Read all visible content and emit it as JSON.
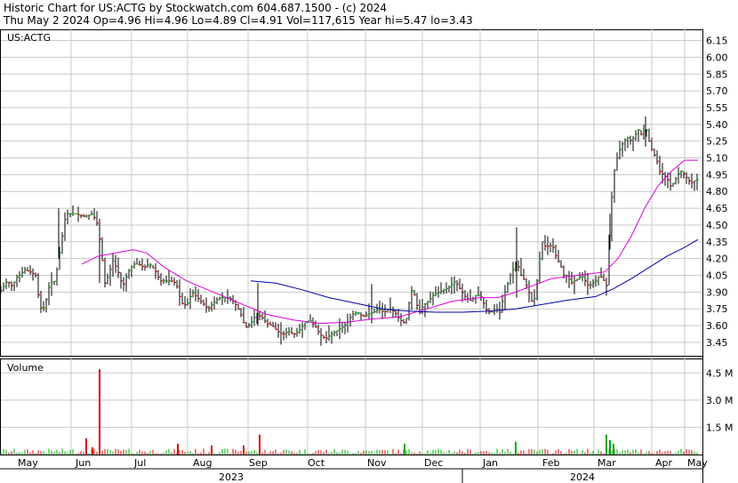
{
  "header": {
    "title": "Historic Chart for US:ACTG by Stockwatch.com 604.687.1500 - (c) 2024",
    "quote": "Thu May  2 2024  Op=4.96  Hi=4.96  Lo=4.89  Cl=4.91  Vol=117,615  Year hi=5.47  lo=3.43"
  },
  "chart_data": [
    {
      "type": "bar",
      "title": "US:ACTG",
      "grid": true,
      "ylim": [
        3.33,
        6.25
      ],
      "yticks": [
        "6.15",
        "6.00",
        "5.85",
        "5.70",
        "5.55",
        "5.40",
        "5.25",
        "5.10",
        "4.95",
        "4.80",
        "4.65",
        "4.50",
        "4.35",
        "4.20",
        "4.05",
        "3.90",
        "3.75",
        "3.60",
        "3.45"
      ],
      "month_labels": [
        "May",
        "Jun",
        "Jul",
        "Aug",
        "Sep",
        "Oct",
        "Nov",
        "Dec",
        "Jan",
        "Feb",
        "Mar",
        "Apr",
        "May"
      ],
      "year_labels": [
        "2023",
        "2024"
      ],
      "anchors": [
        {
          "x": 0,
          "price": 3.9
        },
        {
          "x": 8,
          "price": 4.0
        },
        {
          "x": 14,
          "price": 3.95
        },
        {
          "x": 18,
          "price": 4.03
        },
        {
          "x": 22,
          "price": 4.05
        },
        {
          "x": 28,
          "price": 4.1
        },
        {
          "x": 34,
          "price": 4.08
        },
        {
          "x": 40,
          "price": 4.05
        },
        {
          "x": 45,
          "price": 3.76
        },
        {
          "x": 50,
          "price": 3.76
        },
        {
          "x": 56,
          "price": 3.98
        },
        {
          "x": 62,
          "price": 4.0
        },
        {
          "x": 66,
          "price": 4.2
        },
        {
          "x": 70,
          "price": 4.4
        },
        {
          "x": 74,
          "price": 4.6
        },
        {
          "x": 80,
          "price": 4.6
        },
        {
          "x": 86,
          "price": 4.6
        },
        {
          "x": 92,
          "price": 4.58
        },
        {
          "x": 98,
          "price": 4.58
        },
        {
          "x": 104,
          "price": 4.6
        },
        {
          "x": 110,
          "price": 4.5
        },
        {
          "x": 114,
          "price": 4.25
        },
        {
          "x": 118,
          "price": 3.98
        },
        {
          "x": 122,
          "price": 4.05
        },
        {
          "x": 127,
          "price": 4.18
        },
        {
          "x": 132,
          "price": 4.1
        },
        {
          "x": 138,
          "price": 3.95
        },
        {
          "x": 144,
          "price": 4.08
        },
        {
          "x": 150,
          "price": 4.15
        },
        {
          "x": 156,
          "price": 4.15
        },
        {
          "x": 162,
          "price": 4.12
        },
        {
          "x": 168,
          "price": 4.15
        },
        {
          "x": 174,
          "price": 4.1
        },
        {
          "x": 180,
          "price": 4.0
        },
        {
          "x": 186,
          "price": 4.0
        },
        {
          "x": 192,
          "price": 4.0
        },
        {
          "x": 198,
          "price": 3.98
        },
        {
          "x": 204,
          "price": 3.8
        },
        {
          "x": 210,
          "price": 3.78
        },
        {
          "x": 216,
          "price": 3.9
        },
        {
          "x": 222,
          "price": 3.85
        },
        {
          "x": 228,
          "price": 3.8
        },
        {
          "x": 234,
          "price": 3.75
        },
        {
          "x": 240,
          "price": 3.8
        },
        {
          "x": 246,
          "price": 3.85
        },
        {
          "x": 252,
          "price": 3.85
        },
        {
          "x": 258,
          "price": 3.85
        },
        {
          "x": 264,
          "price": 3.8
        },
        {
          "x": 270,
          "price": 3.72
        },
        {
          "x": 276,
          "price": 3.58
        },
        {
          "x": 282,
          "price": 3.62
        },
        {
          "x": 288,
          "price": 3.7
        },
        {
          "x": 294,
          "price": 3.68
        },
        {
          "x": 300,
          "price": 3.62
        },
        {
          "x": 306,
          "price": 3.6
        },
        {
          "x": 312,
          "price": 3.55
        },
        {
          "x": 318,
          "price": 3.52
        },
        {
          "x": 324,
          "price": 3.55
        },
        {
          "x": 330,
          "price": 3.52
        },
        {
          "x": 336,
          "price": 3.55
        },
        {
          "x": 342,
          "price": 3.62
        },
        {
          "x": 348,
          "price": 3.65
        },
        {
          "x": 354,
          "price": 3.6
        },
        {
          "x": 360,
          "price": 3.52
        },
        {
          "x": 366,
          "price": 3.48
        },
        {
          "x": 372,
          "price": 3.52
        },
        {
          "x": 378,
          "price": 3.55
        },
        {
          "x": 384,
          "price": 3.58
        },
        {
          "x": 390,
          "price": 3.62
        },
        {
          "x": 396,
          "price": 3.7
        },
        {
          "x": 402,
          "price": 3.72
        },
        {
          "x": 408,
          "price": 3.68
        },
        {
          "x": 414,
          "price": 3.7
        },
        {
          "x": 420,
          "price": 3.72
        },
        {
          "x": 426,
          "price": 3.75
        },
        {
          "x": 432,
          "price": 3.72
        },
        {
          "x": 438,
          "price": 3.75
        },
        {
          "x": 444,
          "price": 3.72
        },
        {
          "x": 450,
          "price": 3.65
        },
        {
          "x": 456,
          "price": 3.62
        },
        {
          "x": 460,
          "price": 3.8
        },
        {
          "x": 464,
          "price": 3.95
        },
        {
          "x": 468,
          "price": 3.8
        },
        {
          "x": 472,
          "price": 3.72
        },
        {
          "x": 476,
          "price": 3.78
        },
        {
          "x": 482,
          "price": 3.82
        },
        {
          "x": 488,
          "price": 3.88
        },
        {
          "x": 494,
          "price": 3.9
        },
        {
          "x": 500,
          "price": 3.92
        },
        {
          "x": 506,
          "price": 3.95
        },
        {
          "x": 512,
          "price": 4.0
        },
        {
          "x": 518,
          "price": 3.92
        },
        {
          "x": 524,
          "price": 3.85
        },
        {
          "x": 530,
          "price": 3.82
        },
        {
          "x": 536,
          "price": 3.88
        },
        {
          "x": 542,
          "price": 3.85
        },
        {
          "x": 546,
          "price": 3.75
        },
        {
          "x": 550,
          "price": 3.72
        },
        {
          "x": 554,
          "price": 3.72
        },
        {
          "x": 558,
          "price": 3.75
        },
        {
          "x": 562,
          "price": 3.72
        },
        {
          "x": 566,
          "price": 3.85
        },
        {
          "x": 570,
          "price": 3.95
        },
        {
          "x": 574,
          "price": 4.05
        },
        {
          "x": 578,
          "price": 4.12
        },
        {
          "x": 582,
          "price": 4.15
        },
        {
          "x": 586,
          "price": 4.05
        },
        {
          "x": 590,
          "price": 4.0
        },
        {
          "x": 594,
          "price": 3.92
        },
        {
          "x": 598,
          "price": 3.82
        },
        {
          "x": 602,
          "price": 3.85
        },
        {
          "x": 606,
          "price": 4.15
        },
        {
          "x": 610,
          "price": 4.35
        },
        {
          "x": 614,
          "price": 4.3
        },
        {
          "x": 618,
          "price": 4.32
        },
        {
          "x": 622,
          "price": 4.3
        },
        {
          "x": 626,
          "price": 4.2
        },
        {
          "x": 630,
          "price": 4.15
        },
        {
          "x": 634,
          "price": 4.05
        },
        {
          "x": 638,
          "price": 4.05
        },
        {
          "x": 642,
          "price": 3.98
        },
        {
          "x": 646,
          "price": 4.0
        },
        {
          "x": 650,
          "price": 4.02
        },
        {
          "x": 654,
          "price": 4.05
        },
        {
          "x": 658,
          "price": 4.0
        },
        {
          "x": 662,
          "price": 3.95
        },
        {
          "x": 666,
          "price": 3.98
        },
        {
          "x": 670,
          "price": 4.0
        },
        {
          "x": 674,
          "price": 4.05
        },
        {
          "x": 678,
          "price": 4.02
        },
        {
          "x": 682,
          "price": 3.96
        },
        {
          "x": 686,
          "price": 4.55
        },
        {
          "x": 690,
          "price": 4.95
        },
        {
          "x": 694,
          "price": 5.1
        },
        {
          "x": 698,
          "price": 5.2
        },
        {
          "x": 702,
          "price": 5.25
        },
        {
          "x": 706,
          "price": 5.28
        },
        {
          "x": 710,
          "price": 5.25
        },
        {
          "x": 714,
          "price": 5.3
        },
        {
          "x": 718,
          "price": 5.35
        },
        {
          "x": 722,
          "price": 5.3
        },
        {
          "x": 726,
          "price": 5.38
        },
        {
          "x": 730,
          "price": 5.25
        },
        {
          "x": 734,
          "price": 5.15
        },
        {
          "x": 738,
          "price": 5.1
        },
        {
          "x": 742,
          "price": 4.98
        },
        {
          "x": 746,
          "price": 4.95
        },
        {
          "x": 750,
          "price": 4.92
        },
        {
          "x": 754,
          "price": 4.85
        },
        {
          "x": 758,
          "price": 4.88
        },
        {
          "x": 762,
          "price": 4.95
        },
        {
          "x": 766,
          "price": 4.98
        },
        {
          "x": 770,
          "price": 4.95
        },
        {
          "x": 774,
          "price": 4.9
        },
        {
          "x": 778,
          "price": 4.88
        },
        {
          "x": 782,
          "price": 4.9
        },
        {
          "x": 785,
          "price": 4.91
        }
      ],
      "ma_fast": [
        {
          "x": 92,
          "price": 4.15
        },
        {
          "x": 110,
          "price": 4.22
        },
        {
          "x": 130,
          "price": 4.25
        },
        {
          "x": 150,
          "price": 4.28
        },
        {
          "x": 165,
          "price": 4.25
        },
        {
          "x": 185,
          "price": 4.12
        },
        {
          "x": 210,
          "price": 4.0
        },
        {
          "x": 240,
          "price": 3.9
        },
        {
          "x": 270,
          "price": 3.8
        },
        {
          "x": 300,
          "price": 3.7
        },
        {
          "x": 330,
          "price": 3.65
        },
        {
          "x": 360,
          "price": 3.62
        },
        {
          "x": 390,
          "price": 3.63
        },
        {
          "x": 420,
          "price": 3.66
        },
        {
          "x": 450,
          "price": 3.68
        },
        {
          "x": 480,
          "price": 3.75
        },
        {
          "x": 510,
          "price": 3.82
        },
        {
          "x": 540,
          "price": 3.85
        },
        {
          "x": 560,
          "price": 3.85
        },
        {
          "x": 580,
          "price": 3.9
        },
        {
          "x": 600,
          "price": 3.96
        },
        {
          "x": 620,
          "price": 4.02
        },
        {
          "x": 640,
          "price": 4.04
        },
        {
          "x": 660,
          "price": 4.06
        },
        {
          "x": 680,
          "price": 4.08
        },
        {
          "x": 695,
          "price": 4.2
        },
        {
          "x": 710,
          "price": 4.4
        },
        {
          "x": 725,
          "price": 4.65
        },
        {
          "x": 740,
          "price": 4.85
        },
        {
          "x": 755,
          "price": 4.98
        },
        {
          "x": 770,
          "price": 5.08
        },
        {
          "x": 785,
          "price": 5.08
        }
      ],
      "ma_slow": [
        {
          "x": 282,
          "price": 4.0
        },
        {
          "x": 310,
          "price": 3.98
        },
        {
          "x": 340,
          "price": 3.92
        },
        {
          "x": 370,
          "price": 3.85
        },
        {
          "x": 400,
          "price": 3.8
        },
        {
          "x": 430,
          "price": 3.75
        },
        {
          "x": 460,
          "price": 3.73
        },
        {
          "x": 490,
          "price": 3.72
        },
        {
          "x": 520,
          "price": 3.72
        },
        {
          "x": 550,
          "price": 3.73
        },
        {
          "x": 580,
          "price": 3.75
        },
        {
          "x": 610,
          "price": 3.79
        },
        {
          "x": 640,
          "price": 3.83
        },
        {
          "x": 670,
          "price": 3.86
        },
        {
          "x": 690,
          "price": 3.93
        },
        {
          "x": 710,
          "price": 4.02
        },
        {
          "x": 730,
          "price": 4.12
        },
        {
          "x": 750,
          "price": 4.22
        },
        {
          "x": 770,
          "price": 4.3
        },
        {
          "x": 785,
          "price": 4.37
        }
      ],
      "colors": {
        "up": "#00aa00",
        "down": "#dd0000",
        "bar": "#000000",
        "grid": "#c8c8c8",
        "ma_fast": "#dd00dd",
        "ma_slow": "#0000aa"
      }
    },
    {
      "type": "bar",
      "title": "Volume",
      "ylim": [
        0,
        5.3
      ],
      "yticks": [
        "4.5 M",
        "3.0 M",
        "1.5 M"
      ],
      "spikes": [
        {
          "x": 97,
          "volume_m": 0.9,
          "color": "#dd0000"
        },
        {
          "x": 104,
          "volume_m": 0.4,
          "color": "#dd0000"
        },
        {
          "x": 112,
          "volume_m": 4.7,
          "color": "#dd0000"
        },
        {
          "x": 200,
          "volume_m": 0.6,
          "color": "#dd0000"
        },
        {
          "x": 238,
          "volume_m": 0.5,
          "color": "#dd0000"
        },
        {
          "x": 274,
          "volume_m": 0.5,
          "color": "#dd0000"
        },
        {
          "x": 292,
          "volume_m": 1.1,
          "color": "#dd0000"
        },
        {
          "x": 455,
          "volume_m": 0.6,
          "color": "#00aa00"
        },
        {
          "x": 580,
          "volume_m": 0.7,
          "color": "#00aa00"
        },
        {
          "x": 682,
          "volume_m": 1.1,
          "color": "#00aa00"
        },
        {
          "x": 686,
          "volume_m": 0.8,
          "color": "#00aa00"
        },
        {
          "x": 690,
          "volume_m": 0.6,
          "color": "#00aa00"
        }
      ]
    }
  ]
}
